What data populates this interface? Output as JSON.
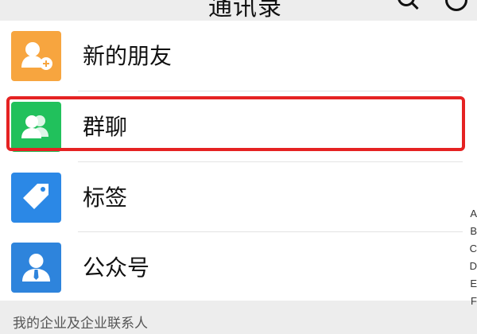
{
  "navbar": {
    "title": "通讯录"
  },
  "list": {
    "items": [
      {
        "label": "新的朋友",
        "icon": "add-friend-icon",
        "color": "#f7a53f"
      },
      {
        "label": "群聊",
        "icon": "group-chat-icon",
        "color": "#21c15c"
      },
      {
        "label": "标签",
        "icon": "tag-icon",
        "color": "#2b88e6"
      },
      {
        "label": "公众号",
        "icon": "official-account-icon",
        "color": "#2e84dc"
      }
    ]
  },
  "section": {
    "label": "我的企业及企业联系人"
  },
  "edge_text": [
    "A",
    "B",
    "C",
    "D",
    "E",
    "F"
  ],
  "highlight": {
    "target": "群聊",
    "color": "#e52222"
  }
}
